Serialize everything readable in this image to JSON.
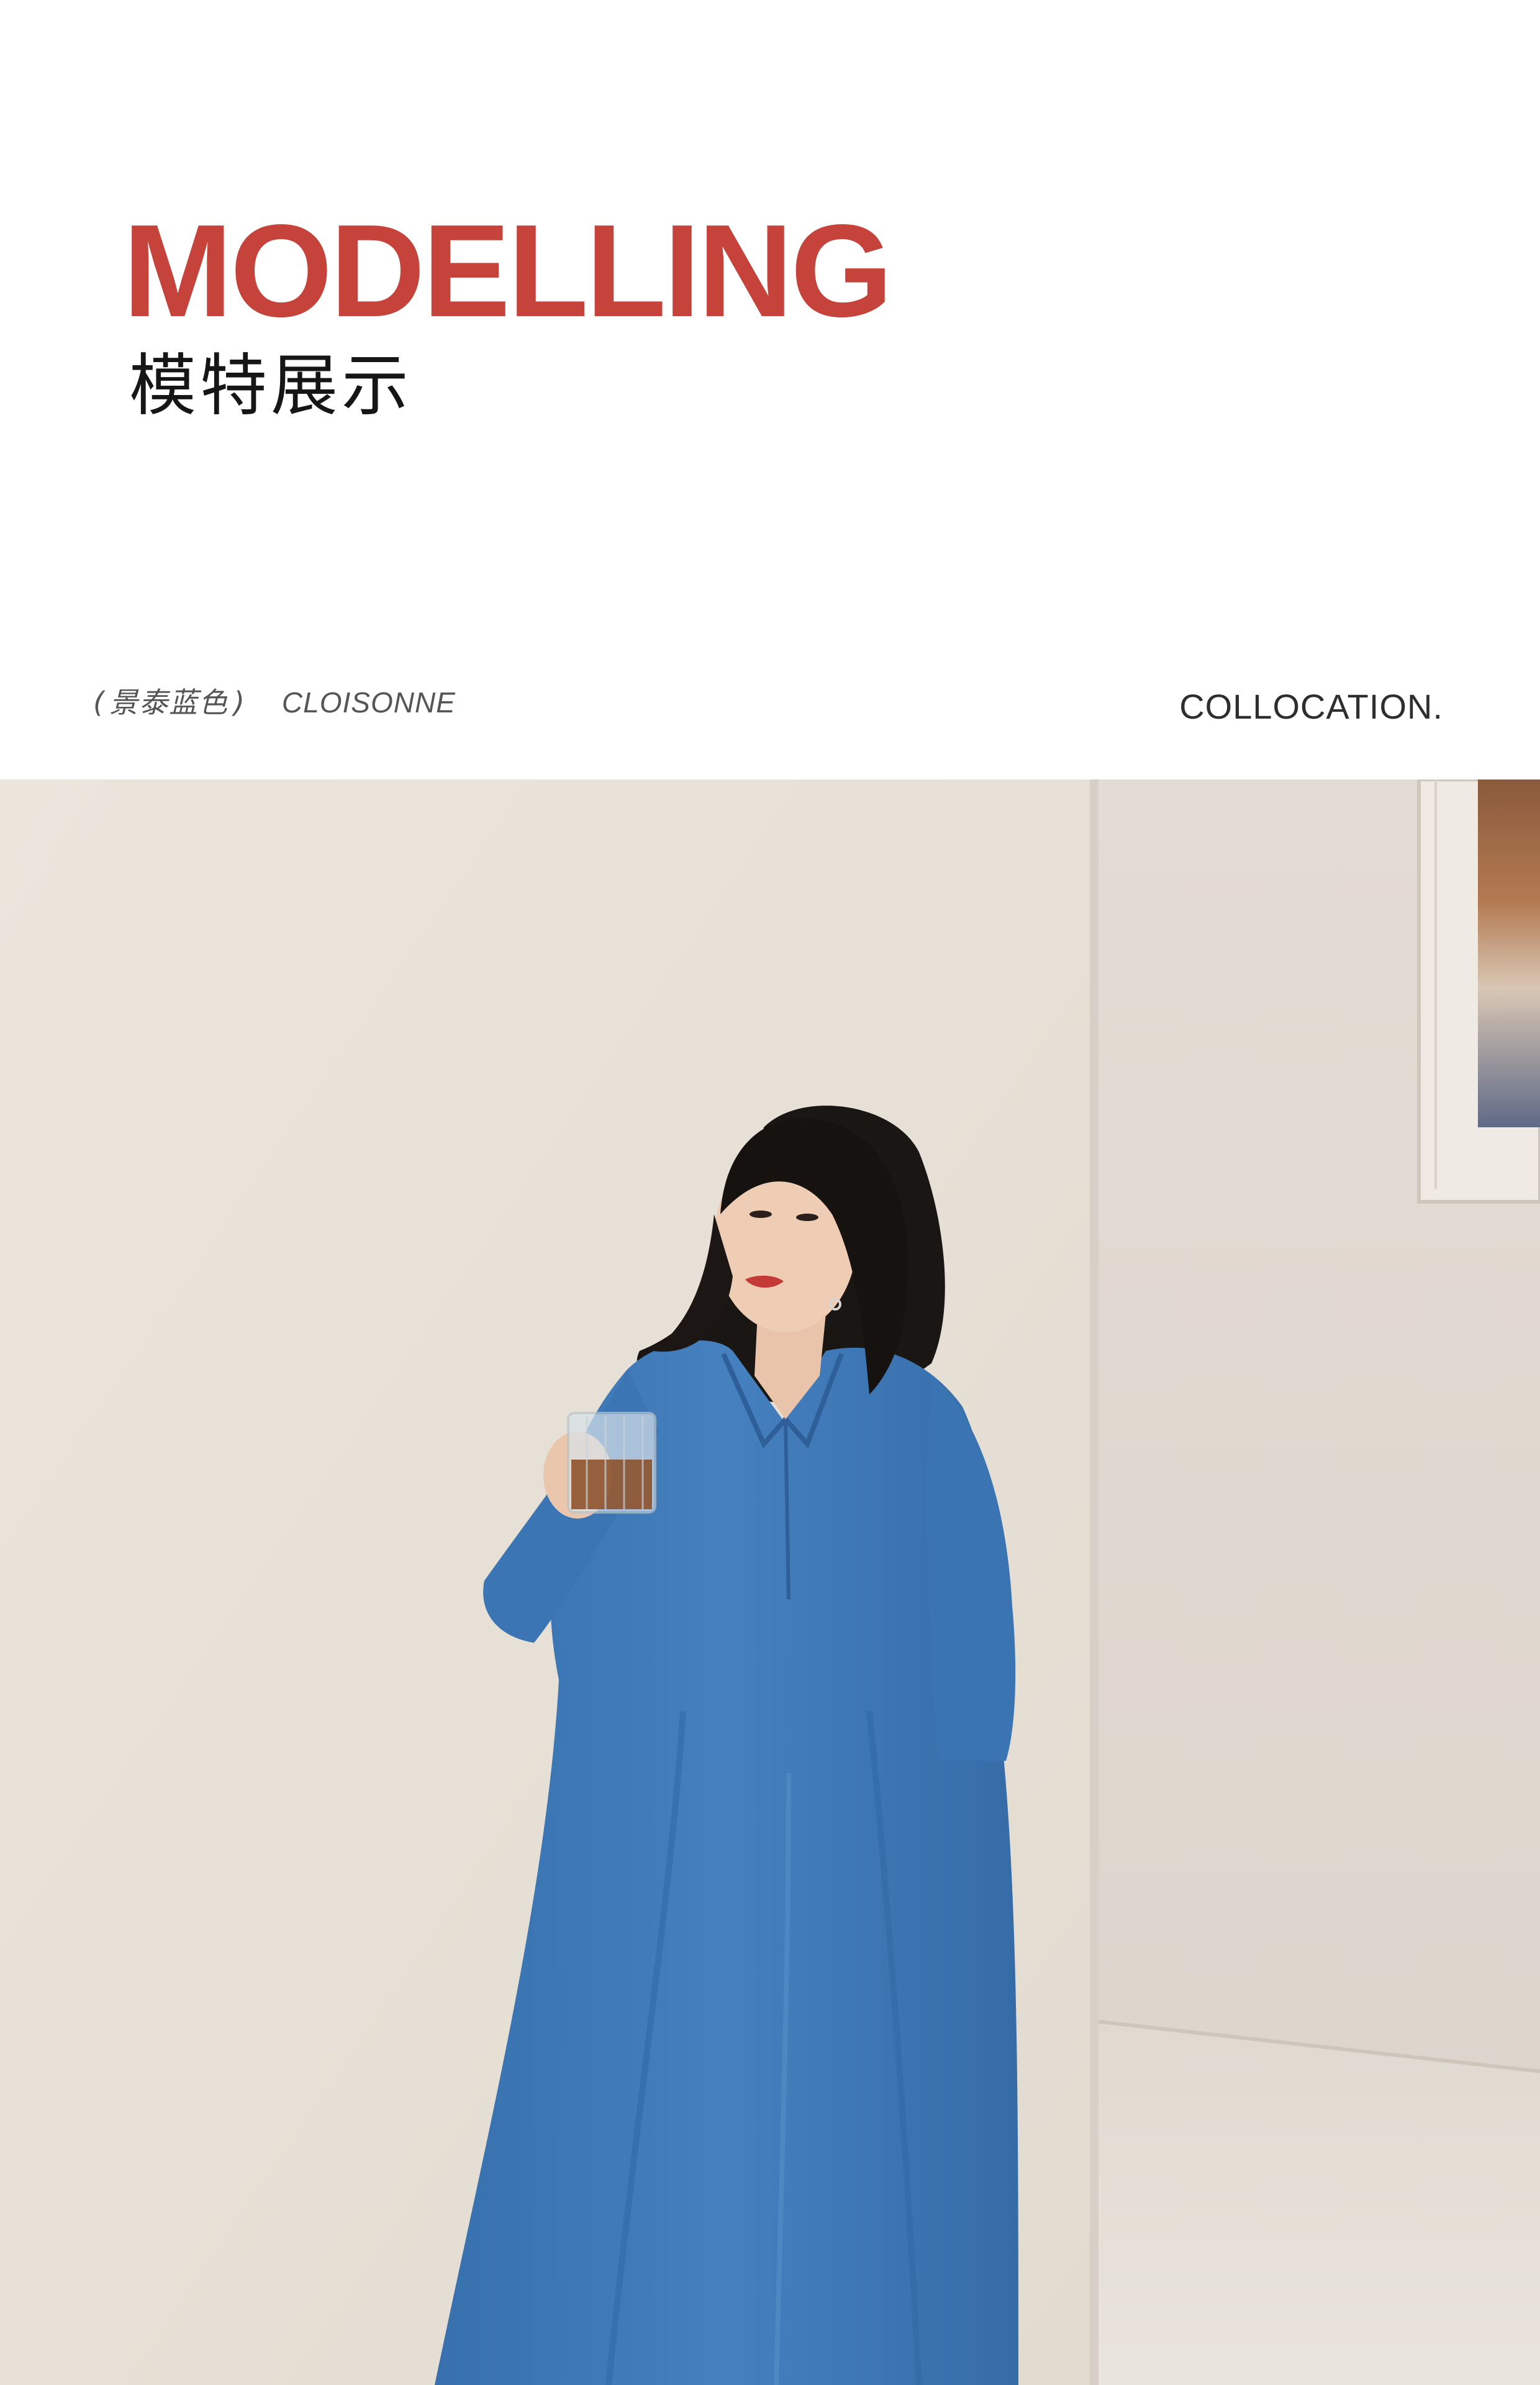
{
  "header": {
    "title_en": "MODELLING",
    "title_zh": "模特展示"
  },
  "color_label": {
    "open_paren": "(",
    "name_zh": "景泰蓝色",
    "close_paren": ")",
    "name_en": "CLOISONNE"
  },
  "collocation_label": "COLLOCATION.",
  "colors": {
    "title_red": "#c5433b",
    "title_black": "#161616",
    "label_gray": "#555555",
    "collocation_gray": "#2e2e2e",
    "wall": "#e9e3da",
    "dress_blue": "#3e7ab8"
  }
}
